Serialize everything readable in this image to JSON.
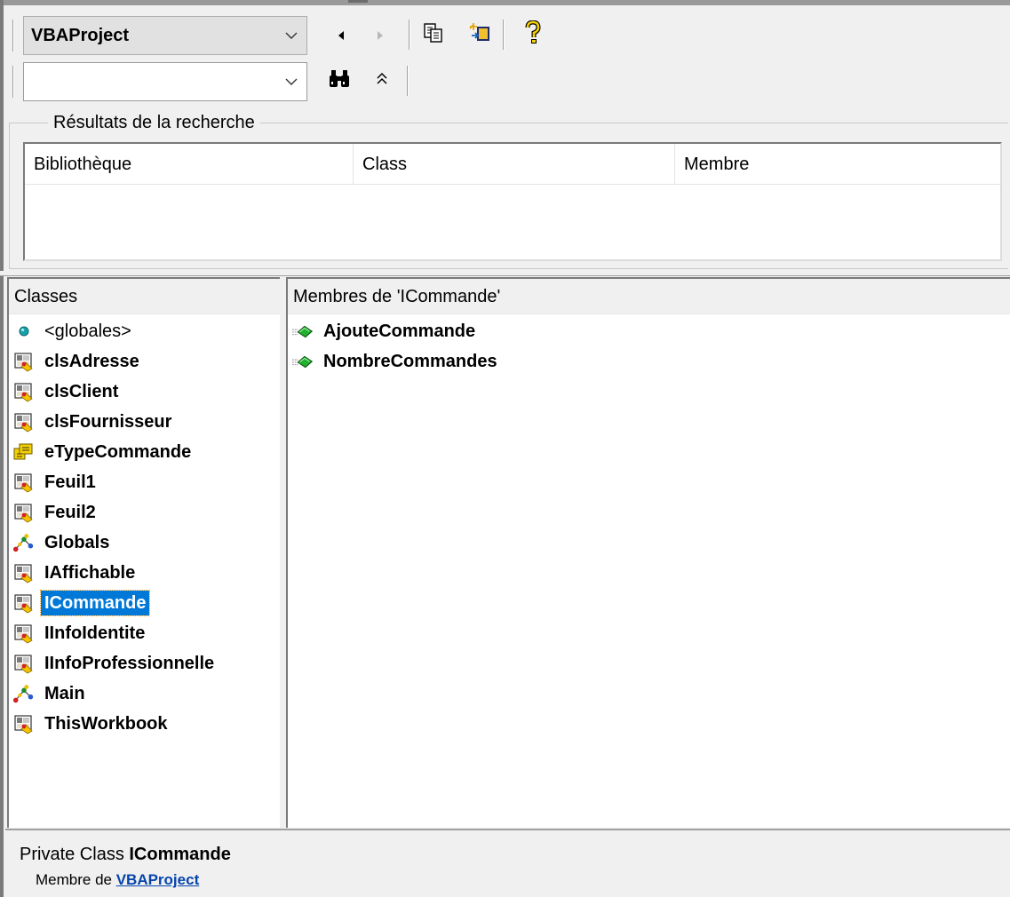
{
  "toolbar": {
    "library_value": "VBAProject",
    "search_value": "",
    "buttons": {
      "back": "back-arrow",
      "forward": "forward-arrow",
      "copy": "copy-to-clipboard",
      "view_definition": "view-definition",
      "help": "help",
      "search": "binoculars",
      "toggle_results": "double-chevron-up"
    }
  },
  "search_results": {
    "title": "Résultats de la recherche",
    "columns": [
      "Bibliothèque",
      "Class",
      "Membre"
    ]
  },
  "classes_pane": {
    "header": "Classes",
    "items": [
      {
        "label": "<globales>",
        "icon": "globals-dot-icon",
        "bold": false
      },
      {
        "label": "clsAdresse",
        "icon": "class-module-icon",
        "bold": true
      },
      {
        "label": "clsClient",
        "icon": "class-module-icon",
        "bold": true
      },
      {
        "label": "clsFournisseur",
        "icon": "class-module-icon",
        "bold": true
      },
      {
        "label": "eTypeCommande",
        "icon": "enum-icon",
        "bold": true
      },
      {
        "label": "Feuil1",
        "icon": "class-module-icon",
        "bold": true
      },
      {
        "label": "Feuil2",
        "icon": "class-module-icon",
        "bold": true
      },
      {
        "label": "Globals",
        "icon": "standard-module-icon",
        "bold": true
      },
      {
        "label": "IAffichable",
        "icon": "class-module-icon",
        "bold": true
      },
      {
        "label": "ICommande",
        "icon": "class-module-icon",
        "bold": true,
        "selected": true
      },
      {
        "label": "IInfoIdentite",
        "icon": "class-module-icon",
        "bold": true
      },
      {
        "label": "IInfoProfessionnelle",
        "icon": "class-module-icon",
        "bold": true
      },
      {
        "label": "Main",
        "icon": "standard-module-icon",
        "bold": true
      },
      {
        "label": "ThisWorkbook",
        "icon": "class-module-icon",
        "bold": true
      }
    ]
  },
  "members_pane": {
    "header": "Membres de 'ICommande'",
    "items": [
      {
        "label": "AjouteCommande",
        "icon": "method-icon"
      },
      {
        "label": "NombreCommandes",
        "icon": "method-icon"
      }
    ]
  },
  "status": {
    "prefix": "Private Class ",
    "name": "ICommande",
    "member_of_label": "Membre de ",
    "member_of_link": "VBAProject"
  }
}
